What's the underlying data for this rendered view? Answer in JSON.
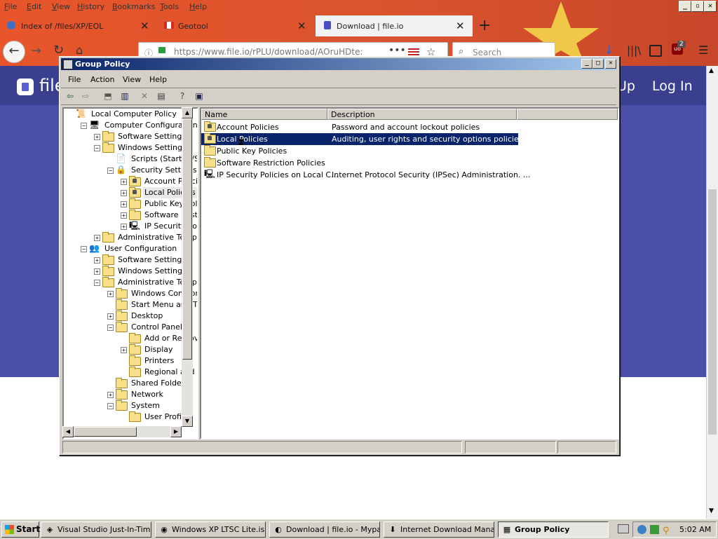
{
  "firefox": {
    "menu": [
      "File",
      "Edit",
      "View",
      "History",
      "Bookmarks",
      "Tools",
      "Help"
    ],
    "window_controls": {
      "minimize": "_",
      "restore": "▫",
      "close": "✕"
    },
    "tabs": [
      {
        "label": "Index of /files/XP/EOL",
        "active": false
      },
      {
        "label": "Geotool",
        "active": false
      },
      {
        "label": "Download | file.io",
        "active": true
      }
    ],
    "new_tab": "+",
    "url": "https://www.file.io/rPLU/download/AOruHDte:",
    "search_placeholder": "Search",
    "badge_count": "2"
  },
  "site": {
    "brand": "file",
    "nav_partial": "Up",
    "login": "Log In"
  },
  "group_policy": {
    "title": "Group Policy",
    "menu": [
      "File",
      "Action",
      "View",
      "Help"
    ],
    "tree": [
      {
        "label": "Local Computer Policy",
        "indent": 0,
        "icon": "computer-policy-icon",
        "exp": ""
      },
      {
        "label": "Computer Configuration",
        "indent": 1,
        "icon": "computer-icon",
        "exp": "-"
      },
      {
        "label": "Software Settings",
        "indent": 2,
        "icon": "folder-icon",
        "exp": "+"
      },
      {
        "label": "Windows Settings",
        "indent": 2,
        "icon": "folder-icon",
        "exp": "-"
      },
      {
        "label": "Scripts (Startup/Shu",
        "indent": 3,
        "icon": "script-icon",
        "exp": ""
      },
      {
        "label": "Security Settings",
        "indent": 3,
        "icon": "security-icon",
        "exp": "-"
      },
      {
        "label": "Account Policies",
        "indent": 4,
        "icon": "folder-lock-icon",
        "exp": "+"
      },
      {
        "label": "Local Policies",
        "indent": 4,
        "icon": "folder-lock-icon",
        "exp": "+",
        "selected": true
      },
      {
        "label": "Public Key Polici",
        "indent": 4,
        "icon": "folder-icon",
        "exp": "+"
      },
      {
        "label": "Software Restri",
        "indent": 4,
        "icon": "folder-icon",
        "exp": "+"
      },
      {
        "label": "IP Security Polic",
        "indent": 4,
        "icon": "ipsec-icon",
        "exp": "+"
      },
      {
        "label": "Administrative Template",
        "indent": 2,
        "icon": "folder-icon",
        "exp": "+"
      },
      {
        "label": "User Configuration",
        "indent": 1,
        "icon": "user-icon",
        "exp": "-"
      },
      {
        "label": "Software Settings",
        "indent": 2,
        "icon": "folder-icon",
        "exp": "+"
      },
      {
        "label": "Windows Settings",
        "indent": 2,
        "icon": "folder-icon",
        "exp": "+"
      },
      {
        "label": "Administrative Template",
        "indent": 2,
        "icon": "folder-icon",
        "exp": "-"
      },
      {
        "label": "Windows Componer",
        "indent": 3,
        "icon": "folder-icon",
        "exp": "+"
      },
      {
        "label": "Start Menu and Tas",
        "indent": 3,
        "icon": "folder-icon",
        "exp": ""
      },
      {
        "label": "Desktop",
        "indent": 3,
        "icon": "folder-icon",
        "exp": "+"
      },
      {
        "label": "Control Panel",
        "indent": 3,
        "icon": "folder-icon",
        "exp": "-"
      },
      {
        "label": "Add or Remove",
        "indent": 4,
        "icon": "folder-icon",
        "exp": ""
      },
      {
        "label": "Display",
        "indent": 4,
        "icon": "folder-icon",
        "exp": "+"
      },
      {
        "label": "Printers",
        "indent": 4,
        "icon": "folder-icon",
        "exp": ""
      },
      {
        "label": "Regional and La",
        "indent": 4,
        "icon": "folder-icon",
        "exp": ""
      },
      {
        "label": "Shared Folders",
        "indent": 3,
        "icon": "folder-icon",
        "exp": ""
      },
      {
        "label": "Network",
        "indent": 3,
        "icon": "folder-icon",
        "exp": "+"
      },
      {
        "label": "System",
        "indent": 3,
        "icon": "folder-icon",
        "exp": "-"
      },
      {
        "label": "User Profiles",
        "indent": 4,
        "icon": "folder-icon",
        "exp": ""
      }
    ],
    "columns": [
      "Name",
      "Description"
    ],
    "items": [
      {
        "name": "Account Policies",
        "description": "Password and account lockout policies",
        "icon": "folder-lock-icon"
      },
      {
        "name": "Local Policies",
        "description": "Auditing, user rights and security options policies",
        "icon": "folder-lock-icon",
        "selected": true
      },
      {
        "name": "Public Key Policies",
        "description": "",
        "icon": "folder-icon"
      },
      {
        "name": "Software Restriction Policies",
        "description": "",
        "icon": "folder-icon"
      },
      {
        "name": "IP Security Policies on Local C...",
        "description": "Internet Protocol Security (IPSec) Administration. ...",
        "icon": "ipsec-icon"
      }
    ]
  },
  "taskbar": {
    "start": "Start",
    "tasks": [
      {
        "label": "Visual Studio Just-In-Tim...",
        "icon": "vs-icon",
        "active": false
      },
      {
        "label": "Windows XP LTSC Lite.is...",
        "icon": "disc-icon",
        "active": false
      },
      {
        "label": "Download | file.io - Mypal",
        "icon": "browser-icon",
        "active": false
      },
      {
        "label": "Internet Download Mana...",
        "icon": "download-icon",
        "active": false
      },
      {
        "label": "Group Policy",
        "icon": "group-policy-icon",
        "active": true
      }
    ],
    "clock": "5:02 AM"
  }
}
